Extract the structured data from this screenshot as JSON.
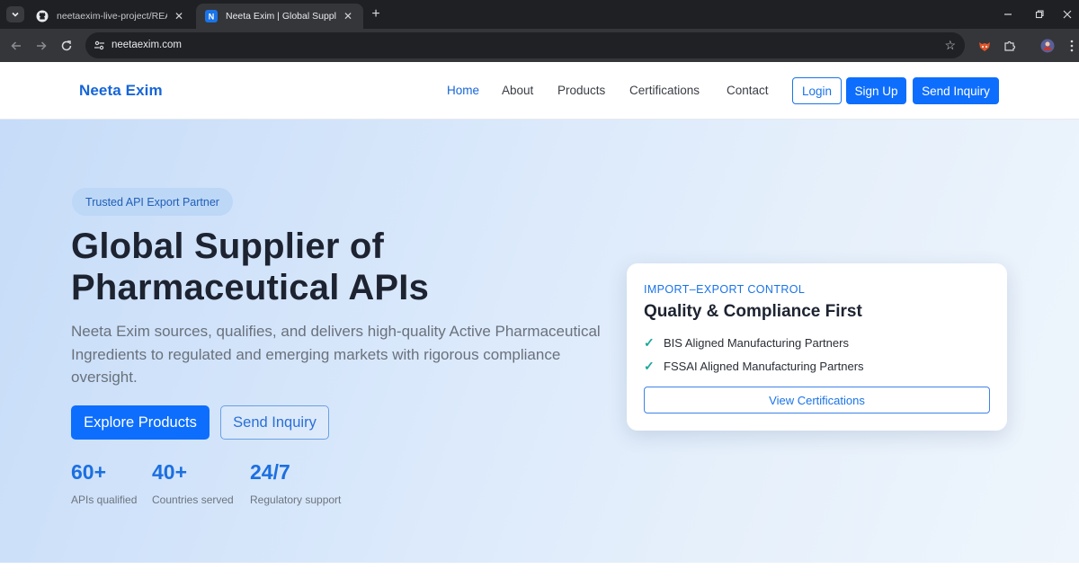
{
  "browser": {
    "tabs": [
      {
        "title": "neetaexim-live-project/README",
        "favicon": "github-icon",
        "active": false
      },
      {
        "title": "Neeta Exim | Global Supplier of",
        "favicon": "N",
        "active": true
      }
    ],
    "address": "neetaexim.com"
  },
  "header": {
    "brand": "Neeta Exim",
    "nav": [
      {
        "label": "Home",
        "active": true
      },
      {
        "label": "About",
        "active": false
      },
      {
        "label": "Products",
        "active": false
      },
      {
        "label": "Certifications",
        "active": false
      },
      {
        "label": "Contact",
        "active": false
      }
    ],
    "login_label": "Login",
    "signup_label": "Sign Up",
    "inquiry_label": "Send Inquiry"
  },
  "hero": {
    "badge": "Trusted API Export Partner",
    "title_line1": "Global Supplier of",
    "title_line2": "Pharmaceutical APIs",
    "description": "Neeta Exim sources, qualifies, and delivers high-quality Active Pharmaceutical Ingredients to regulated and emerging markets with rigorous compliance oversight.",
    "primary_cta": "Explore Products",
    "secondary_cta": "Send Inquiry",
    "stats": [
      {
        "value": "60+",
        "label": "APIs qualified"
      },
      {
        "value": "40+",
        "label": "Countries served"
      },
      {
        "value": "24/7",
        "label": "Regulatory support"
      }
    ]
  },
  "card": {
    "eyebrow": "IMPORT–EXPORT CONTROL",
    "title": "Quality & Compliance First",
    "items": [
      "BIS Aligned Manufacturing Partners",
      "FSSAI Aligned Manufacturing Partners"
    ],
    "button_label": "View Certifications"
  },
  "colors": {
    "brand": "#1665d8",
    "primary_button": "#0d6efd",
    "check": "#1aa89a",
    "heading": "#1d2330"
  }
}
